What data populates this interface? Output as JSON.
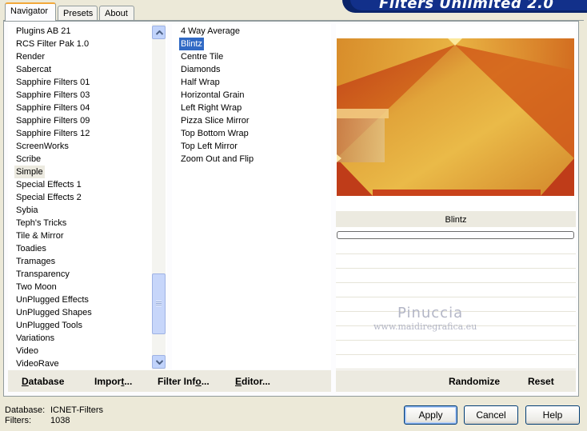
{
  "tabs": [
    "Navigator",
    "Presets",
    "About"
  ],
  "banner_title": "Filters Unlimited 2.0",
  "categories": [
    "Plugins AB 21",
    "RCS Filter Pak 1.0",
    "Render",
    "Sabercat",
    "Sapphire Filters 01",
    "Sapphire Filters 03",
    "Sapphire Filters 04",
    "Sapphire Filters 09",
    "Sapphire Filters 12",
    "ScreenWorks",
    "Scribe",
    "Simple",
    "Special Effects 1",
    "Special Effects 2",
    "Sybia",
    "Teph's Tricks",
    "Tile & Mirror",
    "Toadies",
    "Tramages",
    "Transparency",
    "Two Moon",
    "UnPlugged Effects",
    "UnPlugged Shapes",
    "UnPlugged Tools",
    "Variations",
    "Video",
    "VideoRave"
  ],
  "selected_category": "Simple",
  "filters": [
    "4 Way Average",
    "Blintz",
    "Centre Tile",
    "Diamonds",
    "Half Wrap",
    "Horizontal Grain",
    "Left Right Wrap",
    "Pizza Slice Mirror",
    "Top Bottom Wrap",
    "Top Left Mirror",
    "Zoom Out and Flip"
  ],
  "selected_filter": "Blintz",
  "preview": {
    "filter_name": "Blintz",
    "watermark": "Pinuccia",
    "watermark_url": "www.maidiregrafica.eu"
  },
  "left_buttons": {
    "database": {
      "label": "Database",
      "mnemonic": "D",
      "rest": "atabase"
    },
    "import": {
      "label": "Import...",
      "prefix": "Impor",
      "mnemonic": "t",
      "rest": "..."
    },
    "filter_info": {
      "label": "Filter Info...",
      "prefix": "Filter Inf",
      "mnemonic": "o",
      "rest": "..."
    },
    "editor": {
      "label": "Editor...",
      "mnemonic": "E",
      "rest": "ditor..."
    }
  },
  "right_buttons": {
    "randomize": "Randomize",
    "reset": "Reset"
  },
  "status": {
    "database_label": "Database:",
    "database_value": "ICNET-Filters",
    "filters_label": "Filters:",
    "filters_value": "1038"
  },
  "dialog_buttons": {
    "apply": "Apply",
    "cancel": "Cancel",
    "help": "Help"
  },
  "colors": {
    "selection": "#316ac5",
    "banner": "#0a246a",
    "tab_highlight": "#f2a93b"
  }
}
